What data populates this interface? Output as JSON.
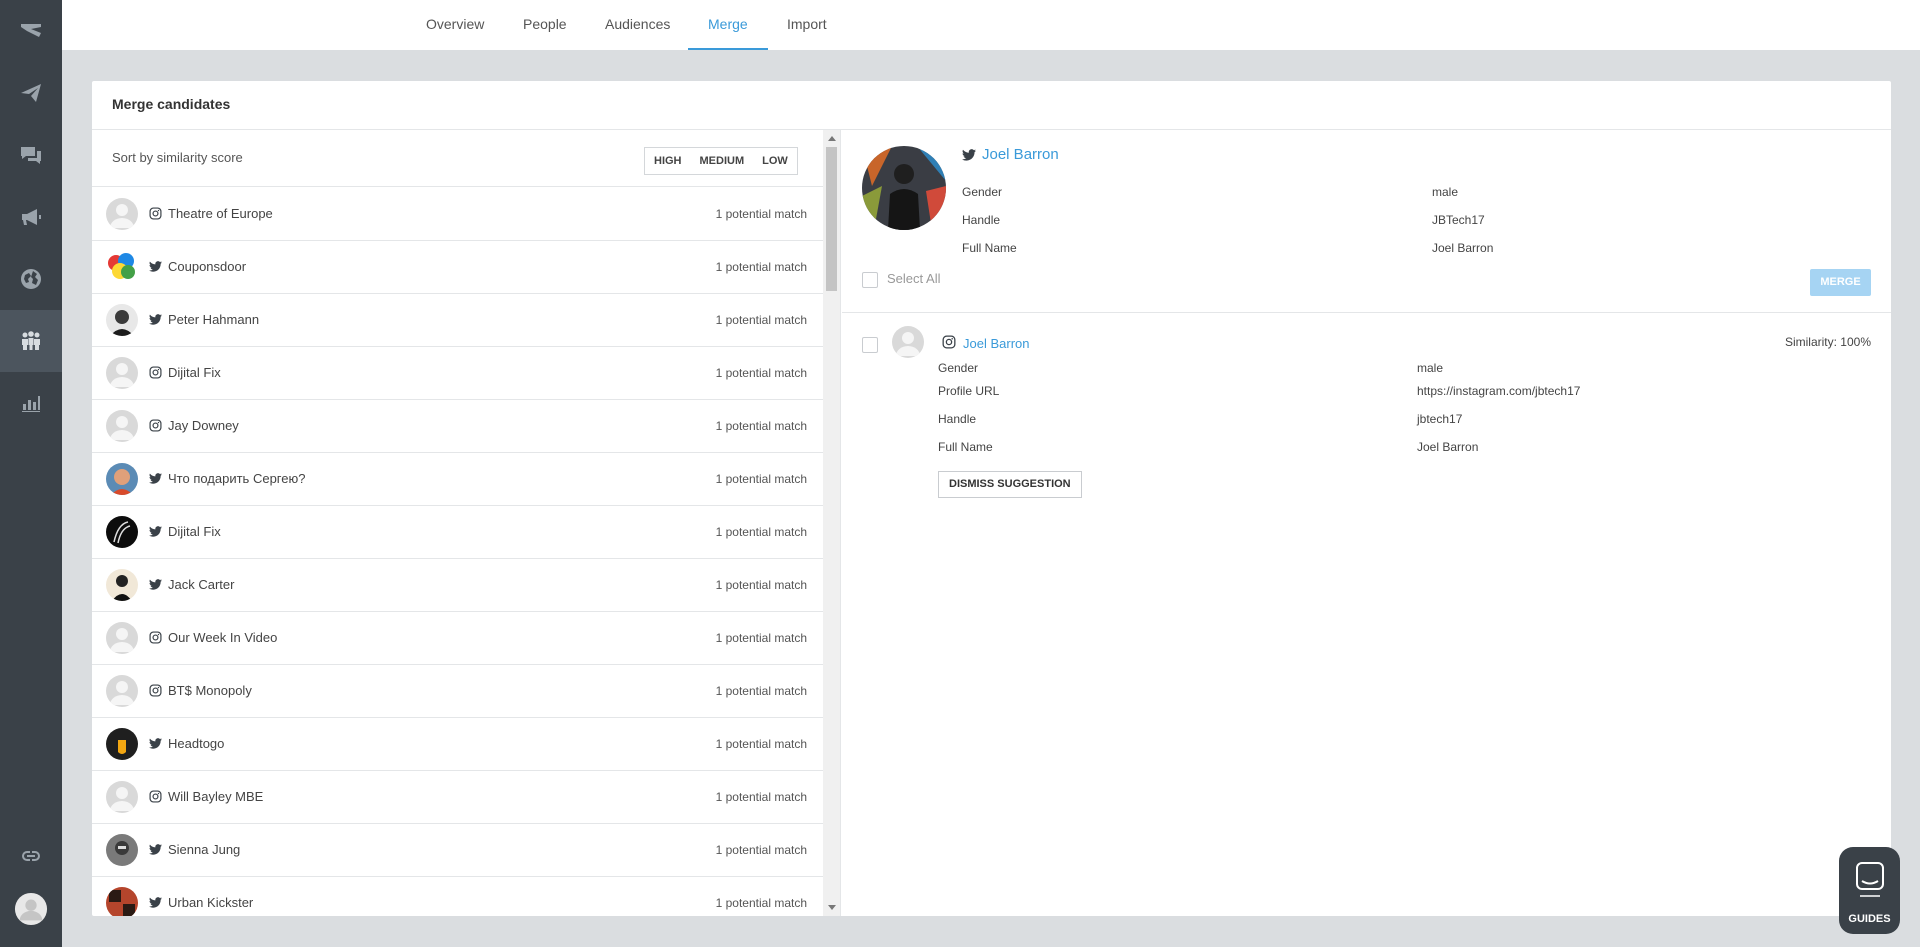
{
  "nav_tabs": [
    {
      "label": "Overview",
      "active": false
    },
    {
      "label": "People",
      "active": false
    },
    {
      "label": "Audiences",
      "active": false
    },
    {
      "label": "Merge",
      "active": true
    },
    {
      "label": "Import",
      "active": false
    }
  ],
  "sidebar_icons": [
    "logo-icon",
    "paper-plane-icon",
    "chat-icon",
    "megaphone-icon",
    "globe-icon",
    "people-icon",
    "bar-chart-icon",
    "link-icon",
    "user-avatar-icon"
  ],
  "card": {
    "title": "Merge candidates"
  },
  "sort": {
    "label": "Sort by similarity score",
    "options": [
      "HIGH",
      "MEDIUM",
      "LOW"
    ]
  },
  "candidates": [
    {
      "name": "Theatre of Europe",
      "network": "instagram",
      "count": "1 potential match"
    },
    {
      "name": "Couponsdoor",
      "network": "twitter",
      "count": "1 potential match"
    },
    {
      "name": "Peter Hahmann",
      "network": "twitter",
      "count": "1 potential match"
    },
    {
      "name": "Dijital Fix",
      "network": "instagram",
      "count": "1 potential match"
    },
    {
      "name": "Jay Downey",
      "network": "instagram",
      "count": "1 potential match"
    },
    {
      "name": "Что подарить Сергею?",
      "network": "twitter",
      "count": "1 potential match"
    },
    {
      "name": "Dijital Fix",
      "network": "twitter",
      "count": "1 potential match"
    },
    {
      "name": "Jack Carter",
      "network": "twitter",
      "count": "1 potential match"
    },
    {
      "name": "Our Week In Video",
      "network": "instagram",
      "count": "1 potential match"
    },
    {
      "name": "BT$ Monopoly",
      "network": "instagram",
      "count": "1 potential match"
    },
    {
      "name": "Headtogo",
      "network": "twitter",
      "count": "1 potential match"
    },
    {
      "name": "Will Bayley MBE",
      "network": "instagram",
      "count": "1 potential match"
    },
    {
      "name": "Sienna Jung",
      "network": "twitter",
      "count": "1 potential match"
    },
    {
      "name": "Urban Kickster",
      "network": "twitter",
      "count": "1 potential match"
    }
  ],
  "selected": {
    "name": "Joel Barron",
    "network": "twitter",
    "attributes": [
      {
        "label": "Gender",
        "value": "male"
      },
      {
        "label": "Handle",
        "value": "JBTech17"
      },
      {
        "label": "Full Name",
        "value": "Joel Barron"
      }
    ],
    "select_all_label": "Select All",
    "merge_label": "MERGE"
  },
  "match": {
    "name": "Joel Barron",
    "network": "instagram",
    "similarity": "Similarity: 100%",
    "attributes": [
      {
        "label": "Gender",
        "value": "male"
      },
      {
        "label": "Profile URL",
        "value": "https://instagram.com/jbtech17"
      },
      {
        "label": "Handle",
        "value": "jbtech17"
      },
      {
        "label": "Full Name",
        "value": "Joel Barron"
      }
    ],
    "dismiss_label": "DISMISS SUGGESTION"
  },
  "guides": {
    "label": "GUIDES"
  }
}
